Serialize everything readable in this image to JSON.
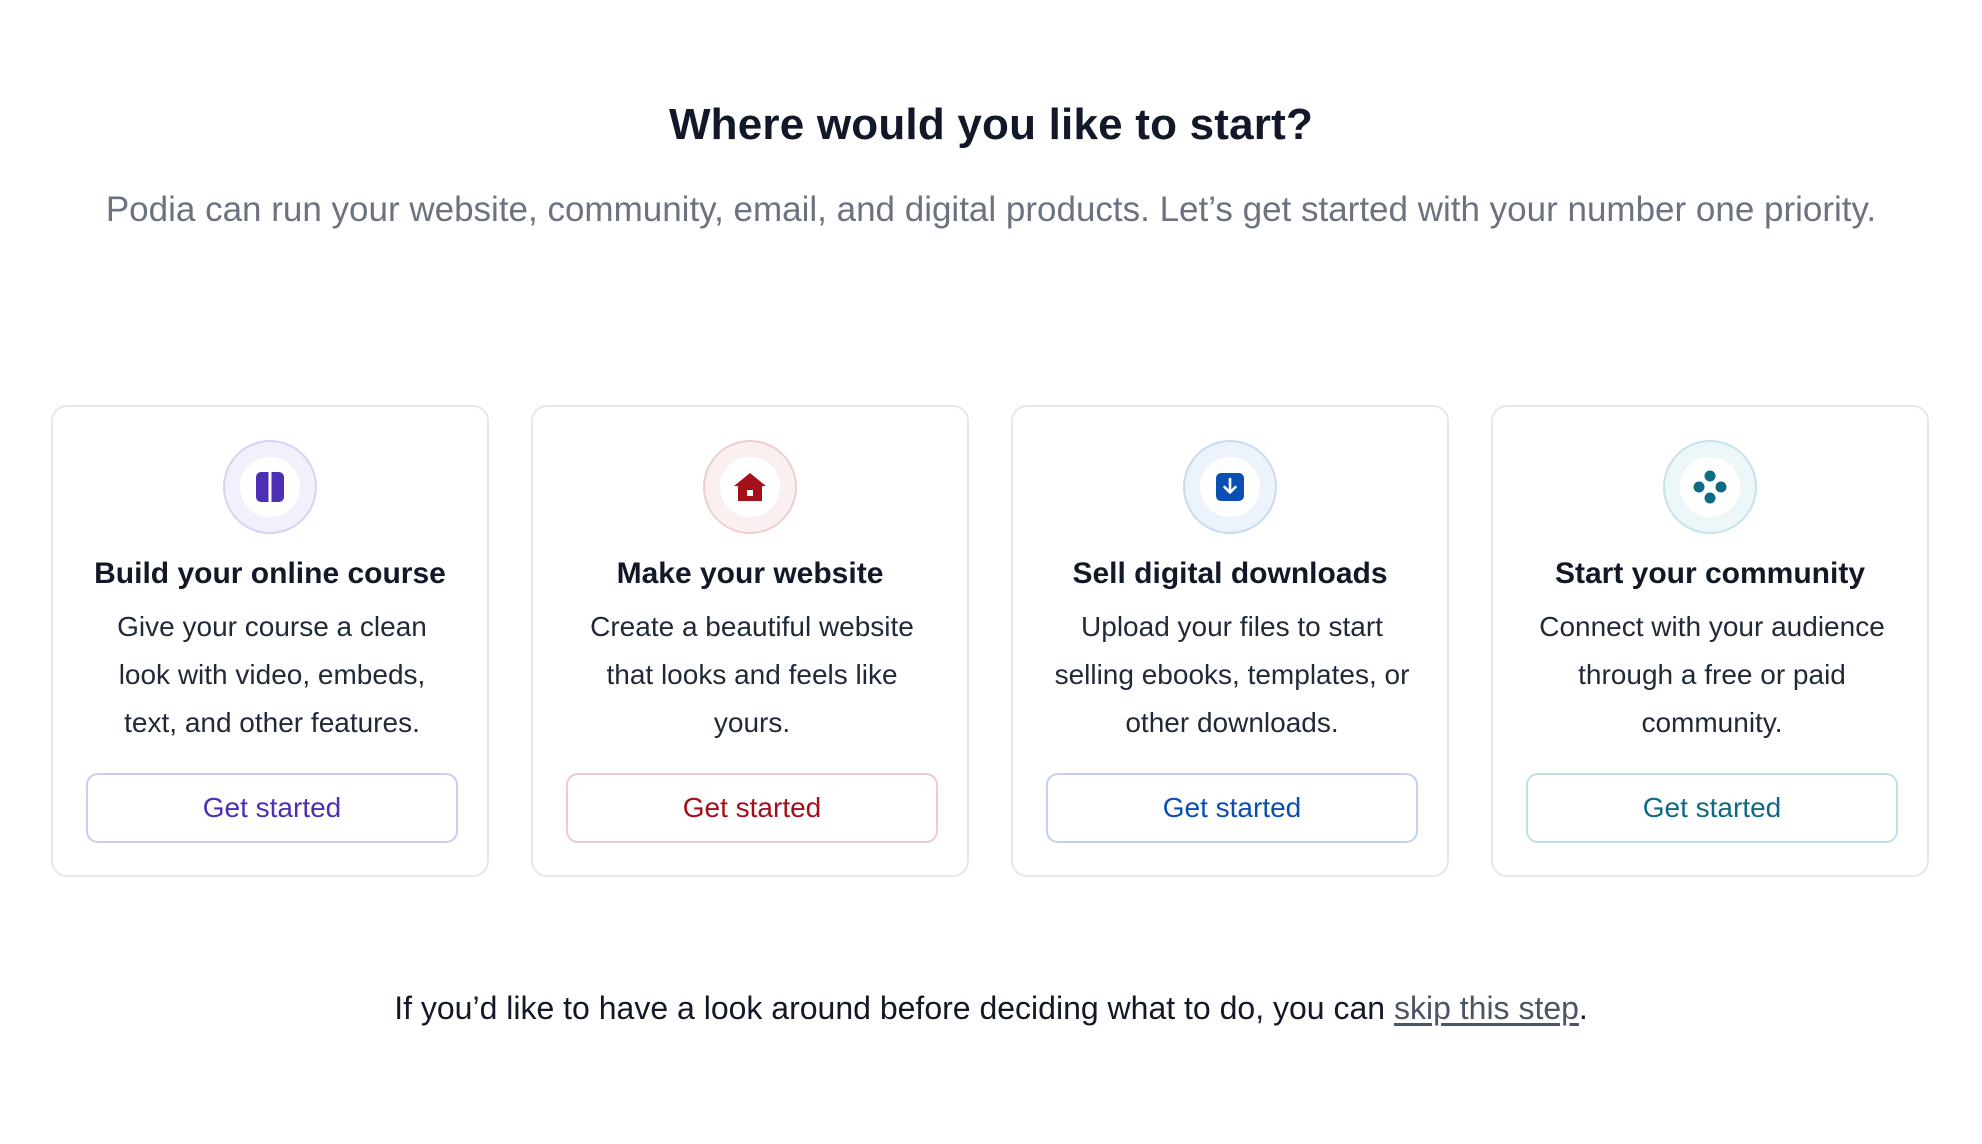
{
  "header": {
    "title": "Where would you like to start?",
    "subtitle": "Podia can run your website, community, email, and digital products. Let’s get started with your number one priority."
  },
  "cards": [
    {
      "title": "Build your online course",
      "description": "Give your course a clean look with video, embeds, text, and other features.",
      "button_label": "Get started",
      "icon": "course-icon",
      "accent": "#4c2fb5",
      "ring_bg": "#f3f0fc",
      "ring_border": "#d9d2f4",
      "button_border": "#cfc8ef"
    },
    {
      "title": "Make your website",
      "description": "Create a beautiful website that looks and feels like yours.",
      "button_label": "Get started",
      "icon": "home-icon",
      "accent": "#a50f1a",
      "ring_bg": "#fbf0f0",
      "ring_border": "#edcfd0",
      "button_border": "#efc9cd"
    },
    {
      "title": "Sell digital downloads",
      "description": "Upload your files to start selling ebooks, templates, or other downloads.",
      "button_label": "Get started",
      "icon": "download-icon",
      "accent": "#0b4fb3",
      "ring_bg": "#edf3fb",
      "ring_border": "#cbdaf0",
      "button_border": "#bed2ef"
    },
    {
      "title": "Start your community",
      "description": "Connect with your audience through a free or paid community.",
      "button_label": "Get started",
      "icon": "community-icon",
      "accent": "#0f6a85",
      "ring_bg": "#edf7fa",
      "ring_border": "#c6e2ea",
      "button_border": "#bfe0ea"
    }
  ],
  "footer": {
    "text_before": "If you’d like to have a look around before deciding what to do, you can ",
    "link_label": "skip this step",
    "text_after": "."
  }
}
